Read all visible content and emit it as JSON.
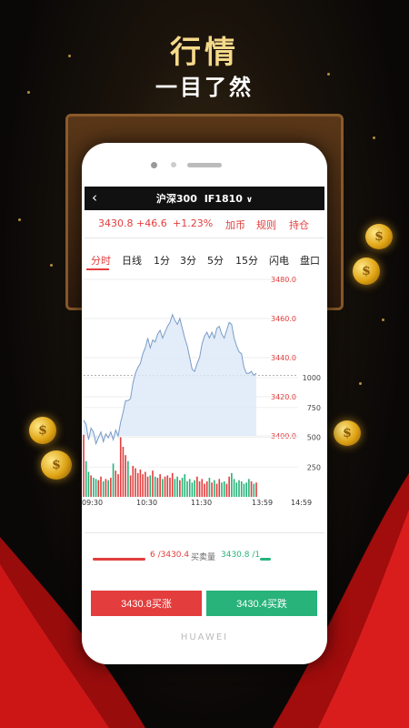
{
  "promo": {
    "headline": "行情",
    "subheadline": "一目了然"
  },
  "instrument": {
    "name": "沪深300",
    "code": "IF1810",
    "back_icon": "back-icon",
    "dropdown_icon": "chevron-down-icon"
  },
  "quote": {
    "price": "3430.8",
    "change": "+46.6",
    "change_pct": "+1.23%"
  },
  "actions": {
    "favorite": "加币",
    "rules": "规则",
    "positions": "持仓"
  },
  "tabs": [
    "分时",
    "日线",
    "1分",
    "3分",
    "5分",
    "15分",
    "闪电",
    "盘口"
  ],
  "active_tab": 0,
  "depth": {
    "bid": "6 /3430.4",
    "label": "买卖量",
    "ask": "3430.8 /1"
  },
  "buttons": {
    "buy": "3430.8买涨",
    "sell": "3430.4买跌"
  },
  "brand": "HUAWEI",
  "colors": {
    "up": "#e33d3d",
    "down": "#27b37a",
    "line": "#7a9cc8",
    "area": "#dbe8f7"
  },
  "chart_data": {
    "type": "line",
    "price_axis": {
      "labels": [
        "3480.0",
        "3460.0",
        "3440.0",
        "3420.0",
        "3400.0"
      ],
      "min": 3400,
      "max": 3480,
      "color": "#e33d3d"
    },
    "volume_axis": {
      "labels": [
        "1000",
        "750",
        "500",
        "250"
      ],
      "max": 1000
    },
    "x_labels": [
      "09:30",
      "10:30",
      "11:30",
      "13:59",
      "14:59"
    ],
    "reference": 3431,
    "price": [
      3408,
      3406,
      3398,
      3404,
      3402,
      3396,
      3399,
      3402,
      3397,
      3401,
      3399,
      3402,
      3398,
      3403,
      3400,
      3407,
      3412,
      3418,
      3418,
      3419,
      3427,
      3432,
      3435,
      3437,
      3442,
      3445,
      3450,
      3445,
      3449,
      3448,
      3452,
      3454,
      3450,
      3453,
      3456,
      3458,
      3462,
      3459,
      3457,
      3460,
      3455,
      3450,
      3446,
      3440,
      3434,
      3433,
      3437,
      3440,
      3447,
      3451,
      3453,
      3450,
      3453,
      3450,
      3455,
      3456,
      3452,
      3450,
      3454,
      3458,
      3457,
      3450,
      3446,
      3443,
      3442,
      3435,
      3432,
      3432,
      3433,
      3431,
      3432
    ],
    "volume": [
      520,
      300,
      210,
      180,
      160,
      150,
      140,
      170,
      130,
      150,
      140,
      160,
      280,
      220,
      190,
      500,
      420,
      350,
      300,
      180,
      260,
      240,
      200,
      230,
      190,
      210,
      170,
      180,
      220,
      170,
      160,
      190,
      150,
      170,
      180,
      160,
      200,
      150,
      170,
      140,
      160,
      190,
      130,
      150,
      120,
      140,
      170,
      130,
      150,
      110,
      130,
      160,
      120,
      140,
      110,
      150,
      120,
      130,
      110,
      170,
      200,
      150,
      120,
      140,
      130,
      110,
      120,
      150,
      130,
      110,
      120
    ],
    "volume_up": [
      1,
      0,
      0,
      1,
      0,
      0,
      1,
      1,
      0,
      1,
      0,
      1,
      0,
      1,
      1,
      1,
      1,
      1,
      0,
      1,
      1,
      1,
      1,
      1,
      1,
      1,
      1,
      0,
      1,
      0,
      1,
      1,
      0,
      1,
      1,
      1,
      1,
      0,
      0,
      1,
      0,
      0,
      0,
      0,
      0,
      0,
      1,
      1,
      1,
      1,
      1,
      0,
      1,
      0,
      1,
      1,
      0,
      0,
      1,
      1,
      0,
      0,
      0,
      0,
      0,
      0,
      0,
      0,
      1,
      0,
      1
    ]
  }
}
